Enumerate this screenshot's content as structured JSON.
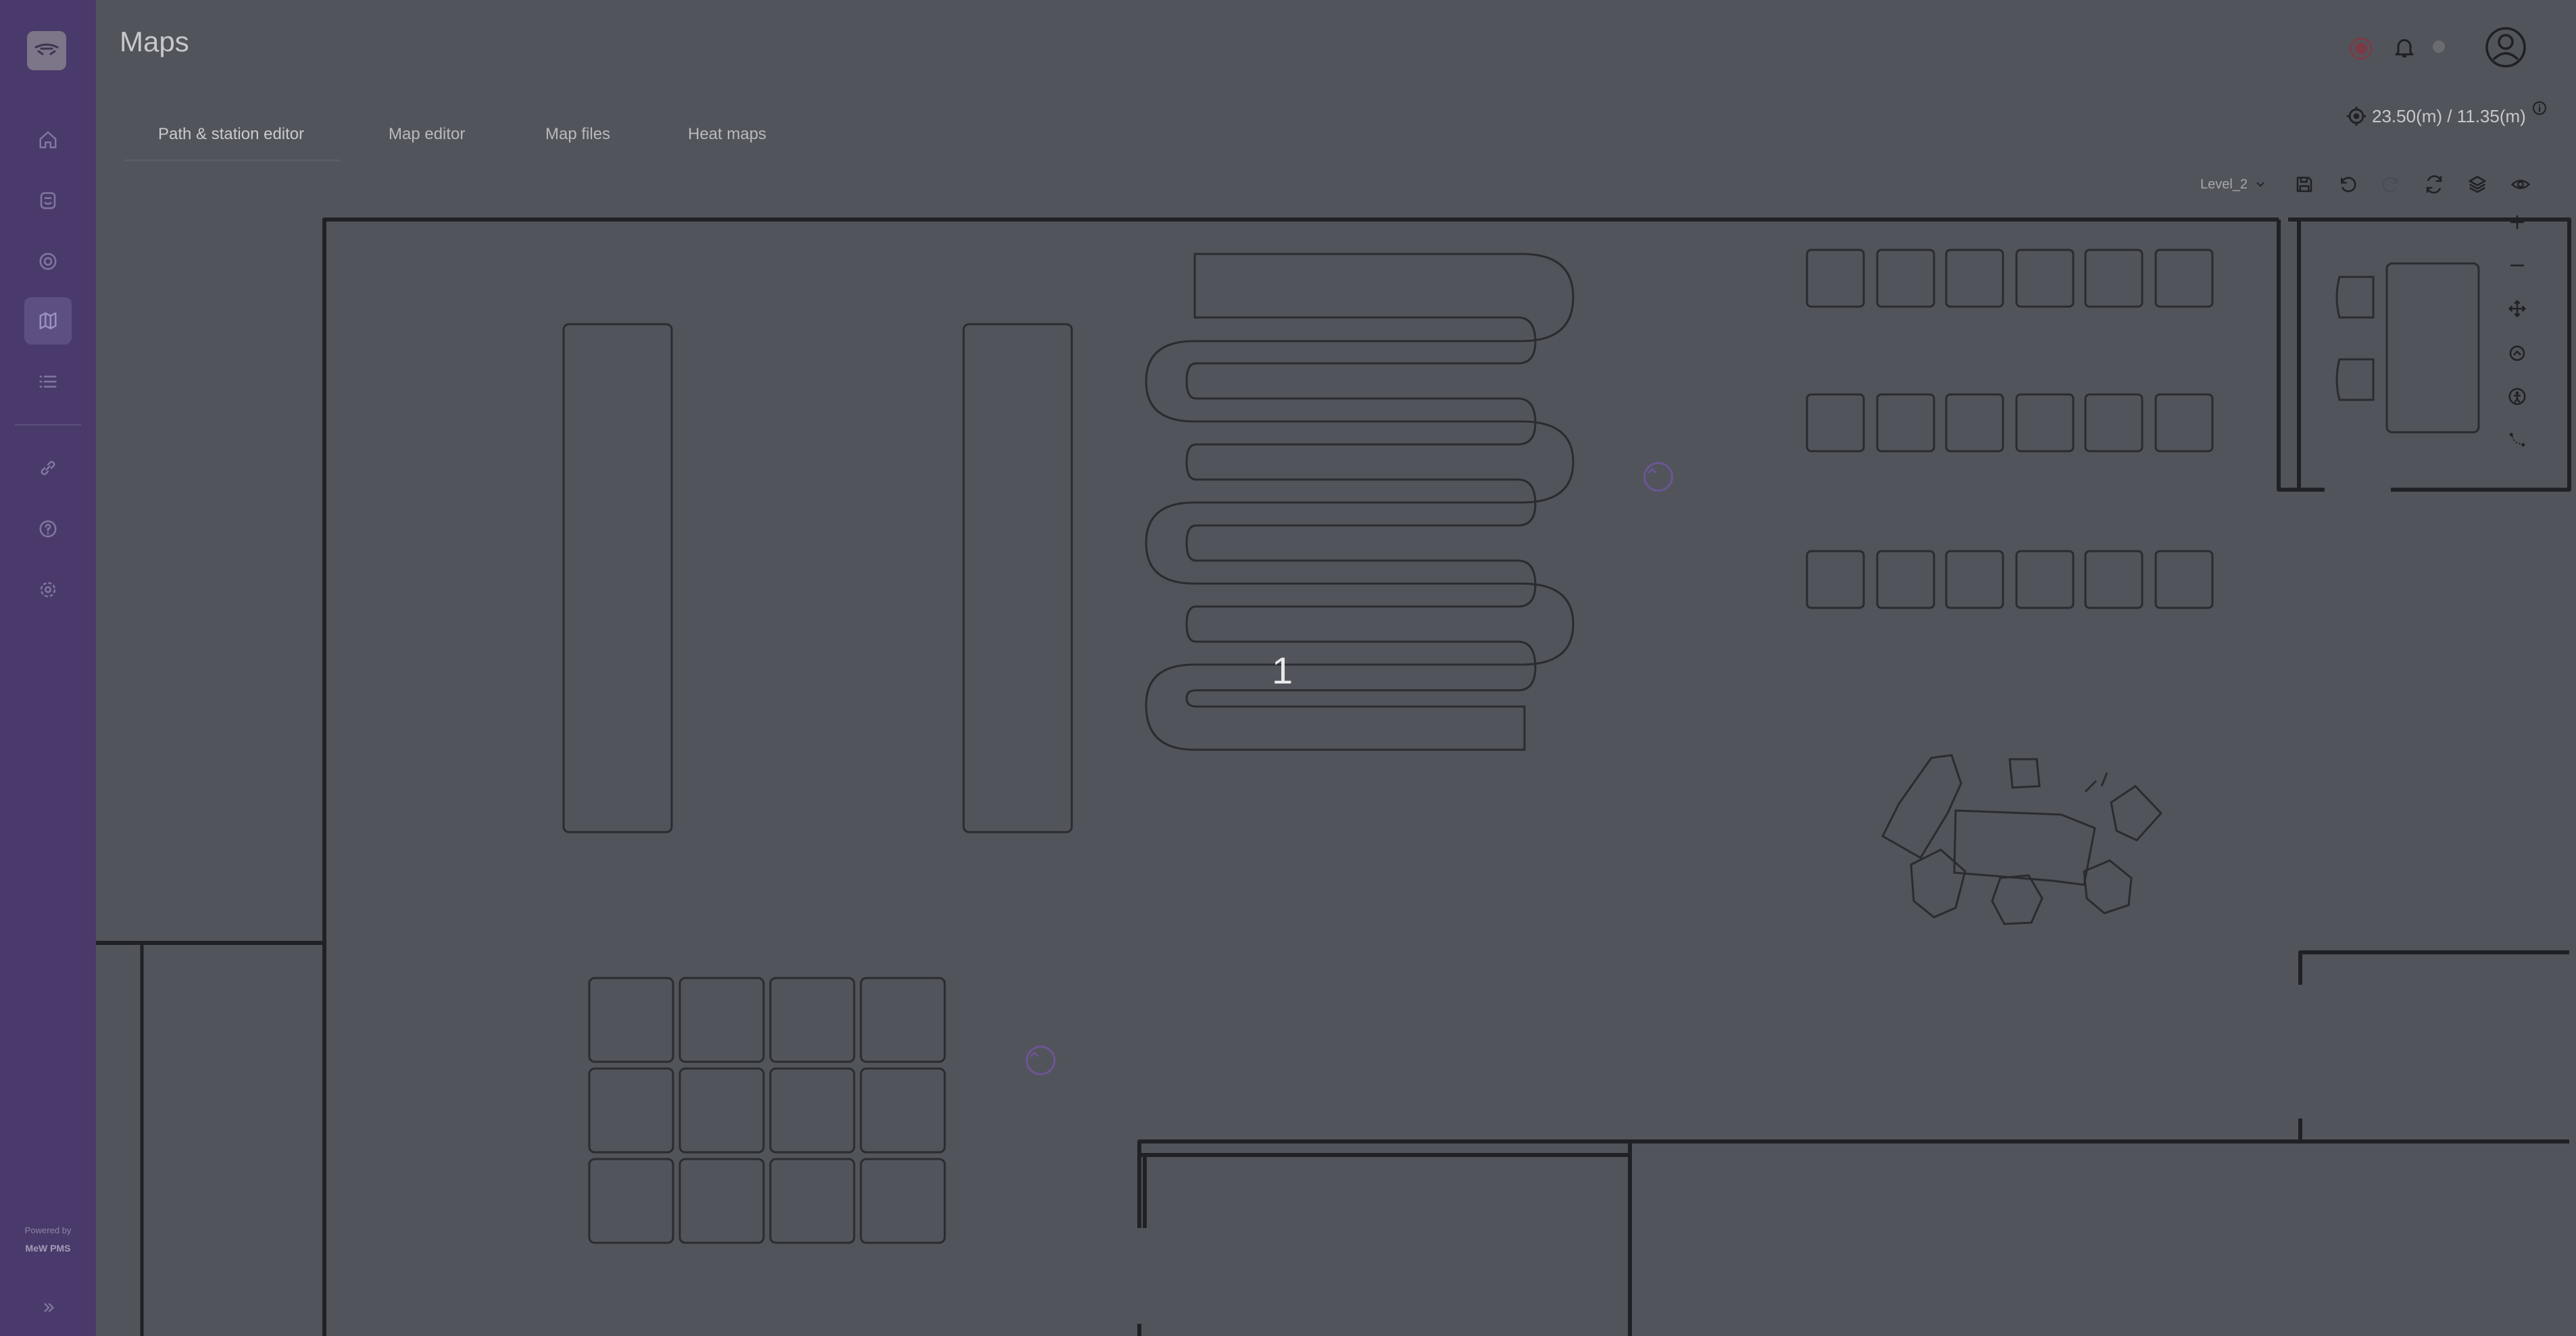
{
  "app": {
    "title": "Maps"
  },
  "sidebar": {
    "items": [
      {
        "name": "home-icon"
      },
      {
        "name": "robot-icon"
      },
      {
        "name": "target-icon"
      },
      {
        "name": "map-icon",
        "active": true
      },
      {
        "name": "list-icon"
      },
      {
        "name": "link-icon"
      },
      {
        "name": "help-icon"
      },
      {
        "name": "settings-icon"
      }
    ],
    "powered_by": "Powered by",
    "powered_brand": "MeW PMS"
  },
  "header": {
    "coordinates": "23.50(m) / 11.35(m)"
  },
  "tabs": [
    {
      "label": "Path & station editor",
      "active": true
    },
    {
      "label": "Map editor"
    },
    {
      "label": "Map files"
    },
    {
      "label": "Heat maps"
    }
  ],
  "toolbar": {
    "level": "Level_2"
  },
  "map": {
    "area_label": "1"
  },
  "colors": {
    "sidebar_bg": "#4a3a6b",
    "canvas_bg": "#52545b",
    "accent": "#6c5596",
    "wall": "#1f2126"
  }
}
